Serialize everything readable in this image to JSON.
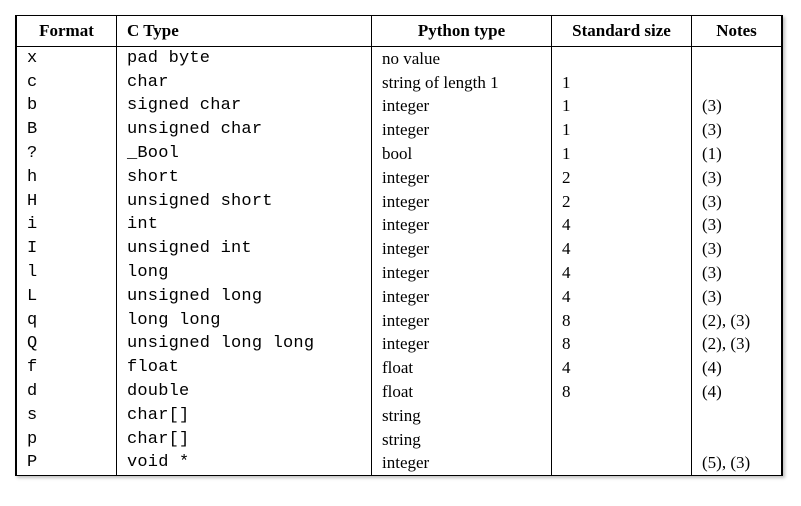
{
  "headers": {
    "format": "Format",
    "ctype": "C Type",
    "pytype": "Python type",
    "stdsize": "Standard size",
    "notes": "Notes"
  },
  "rows": [
    {
      "format": "x",
      "ctype": "pad byte",
      "pytype": "no value",
      "stdsize": "",
      "notes": ""
    },
    {
      "format": "c",
      "ctype": "char",
      "pytype": "string of length 1",
      "stdsize": "1",
      "notes": ""
    },
    {
      "format": "b",
      "ctype": "signed char",
      "pytype": "integer",
      "stdsize": "1",
      "notes": "(3)"
    },
    {
      "format": "B",
      "ctype": "unsigned char",
      "pytype": "integer",
      "stdsize": "1",
      "notes": "(3)"
    },
    {
      "format": "?",
      "ctype": "_Bool",
      "pytype": "bool",
      "stdsize": "1",
      "notes": "(1)"
    },
    {
      "format": "h",
      "ctype": "short",
      "pytype": "integer",
      "stdsize": "2",
      "notes": "(3)"
    },
    {
      "format": "H",
      "ctype": "unsigned short",
      "pytype": "integer",
      "stdsize": "2",
      "notes": "(3)"
    },
    {
      "format": "i",
      "ctype": "int",
      "pytype": "integer",
      "stdsize": "4",
      "notes": "(3)"
    },
    {
      "format": "I",
      "ctype": "unsigned int",
      "pytype": "integer",
      "stdsize": "4",
      "notes": "(3)"
    },
    {
      "format": "l",
      "ctype": "long",
      "pytype": "integer",
      "stdsize": "4",
      "notes": "(3)"
    },
    {
      "format": "L",
      "ctype": "unsigned long",
      "pytype": "integer",
      "stdsize": "4",
      "notes": "(3)"
    },
    {
      "format": "q",
      "ctype": "long long",
      "pytype": "integer",
      "stdsize": "8",
      "notes": "(2), (3)"
    },
    {
      "format": "Q",
      "ctype": "unsigned long long",
      "pytype": "integer",
      "stdsize": "8",
      "notes": "(2), (3)"
    },
    {
      "format": "f",
      "ctype": "float",
      "pytype": "float",
      "stdsize": "4",
      "notes": "(4)"
    },
    {
      "format": "d",
      "ctype": "double",
      "pytype": "float",
      "stdsize": "8",
      "notes": "(4)"
    },
    {
      "format": "s",
      "ctype": "char[]",
      "pytype": "string",
      "stdsize": "",
      "notes": ""
    },
    {
      "format": "p",
      "ctype": "char[]",
      "pytype": "string",
      "stdsize": "",
      "notes": ""
    },
    {
      "format": "P",
      "ctype": "void *",
      "pytype": "integer",
      "stdsize": "",
      "notes": "(5), (3)"
    }
  ]
}
